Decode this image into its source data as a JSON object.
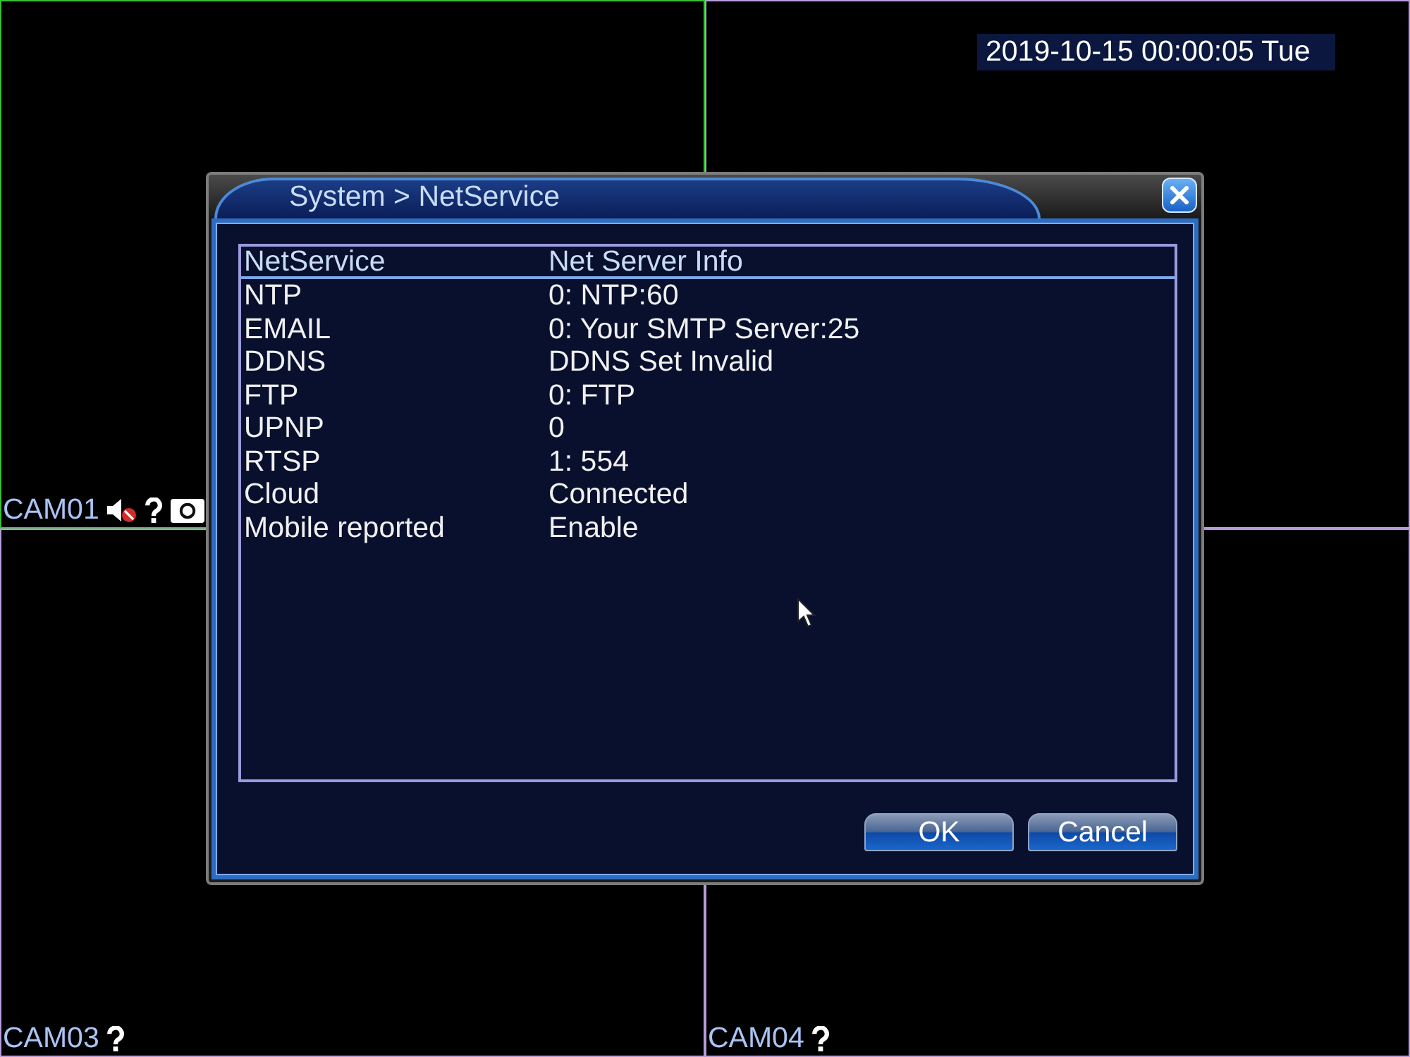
{
  "tiles": [
    {
      "label": "CAM01",
      "selected": true,
      "icons": [
        {
          "kind": "mute"
        },
        {
          "kind": "question"
        },
        {
          "kind": "record"
        }
      ]
    },
    {
      "selected": false
    },
    {
      "label": "CAM03",
      "selected": false,
      "icons": [
        {
          "kind": "question"
        }
      ]
    },
    {
      "label": "CAM04",
      "selected": false,
      "icons": [
        {
          "kind": "question"
        }
      ]
    }
  ],
  "clock": "2019-10-15 00:00:05 Tue",
  "dialog": {
    "title": "System > NetService",
    "table": {
      "columns": [
        "NetService",
        "Net Server Info"
      ],
      "rows": [
        [
          "NTP",
          "0: NTP:60"
        ],
        [
          "EMAIL",
          "0: Your SMTP Server:25"
        ],
        [
          "DDNS",
          "DDNS Set Invalid"
        ],
        [
          "FTP",
          "0: FTP"
        ],
        [
          "UPNP",
          "0"
        ],
        [
          "RTSP",
          "1: 554"
        ],
        [
          "Cloud",
          "Connected"
        ],
        [
          "Mobile reported",
          "Enable"
        ]
      ]
    },
    "buttons": [
      "OK",
      "Cancel"
    ]
  }
}
